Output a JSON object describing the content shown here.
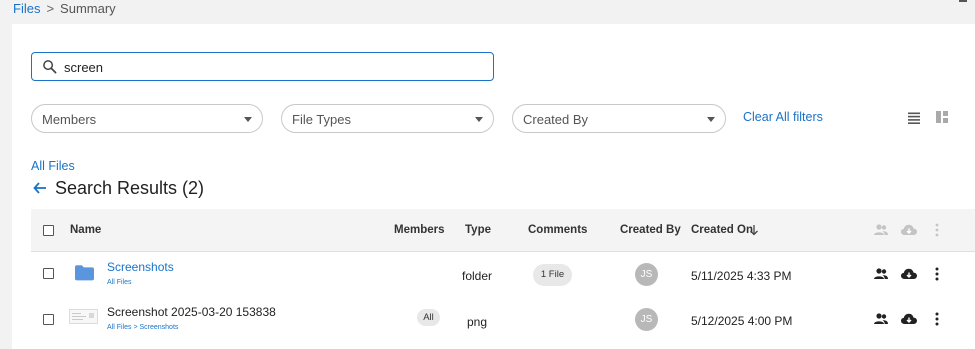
{
  "breadcrumb": {
    "root": "Files",
    "separator": ">",
    "current": "Summary"
  },
  "search": {
    "value": "screen",
    "icon": "search-icon"
  },
  "filters": {
    "members": "Members",
    "file_types": "File Types",
    "created_by": "Created By",
    "clear": "Clear All filters"
  },
  "view_icons": [
    "list-view-icon",
    "grid-view-icon"
  ],
  "nav": {
    "all_files": "All Files"
  },
  "results": {
    "title": "Search Results (2)"
  },
  "table": {
    "columns": {
      "name": "Name",
      "members": "Members",
      "type": "Type",
      "comments": "Comments",
      "created_by": "Created By",
      "created_on": "Created On"
    },
    "rows": [
      {
        "name": "Screenshots",
        "path": "All Files",
        "members": "",
        "type": "folder",
        "comments": "1 File",
        "created_by": "JS",
        "created_on": "5/11/2025 4:33 PM"
      },
      {
        "name": "Screenshot 2025-03-20 153838",
        "path": "All Files > Screenshots",
        "members": "All",
        "type": "png",
        "comments": "",
        "created_by": "JS",
        "created_on": "5/12/2025 4:00 PM"
      }
    ]
  },
  "colors": {
    "accent": "#1a73c8",
    "folder": "#5b95dd",
    "header_bg": "#f4f4f4"
  }
}
